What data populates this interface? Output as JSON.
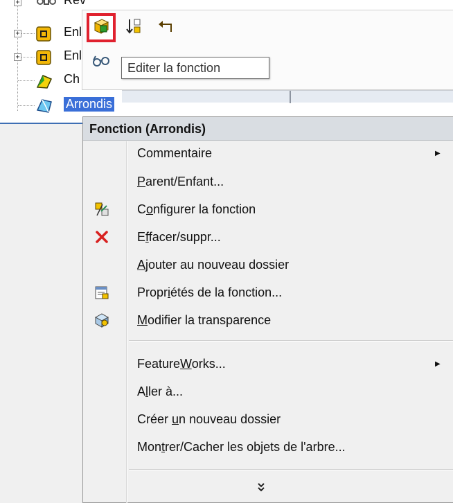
{
  "tree": {
    "items": [
      {
        "label": "Rev",
        "expander": "+",
        "icon": "revolve-feature-icon"
      },
      {
        "label": "Enl",
        "expander": "+",
        "icon": "cut-extrude-feature-icon"
      },
      {
        "label": "Enl",
        "expander": "+",
        "icon": "cut-extrude-feature-icon"
      },
      {
        "label": "Ch",
        "expander": "",
        "icon": "chamfer-feature-icon"
      },
      {
        "label": "Arrondis",
        "expander": "",
        "icon": "fillet-feature-icon",
        "selected": true
      }
    ]
  },
  "toolbar": {
    "buttons": [
      {
        "name": "edit-feature-button",
        "icon": "edit-feature-icon",
        "highlighted": true
      },
      {
        "name": "rollback-button",
        "icon": "rollback-icon"
      },
      {
        "name": "undo-button",
        "icon": "undo-arrow-icon"
      },
      {
        "name": "hide-show-button",
        "icon": "glasses-icon"
      }
    ],
    "tooltip": "Editer la fonction"
  },
  "menu": {
    "header": "Fonction (Arrondis)",
    "items": [
      {
        "pre": "Commentaire",
        "u": "",
        "post": "",
        "submenu": true,
        "icon": ""
      },
      {
        "pre": "",
        "u": "P",
        "post": "arent/Enfant...",
        "submenu": false,
        "icon": ""
      },
      {
        "pre": "C",
        "u": "o",
        "post": "nfigurer la fonction",
        "submenu": false,
        "icon": "configure-feature-icon"
      },
      {
        "pre": "E",
        "u": "f",
        "post": "facer/suppr...",
        "submenu": false,
        "icon": "delete-x-icon"
      },
      {
        "pre": "",
        "u": "A",
        "post": "jouter au nouveau dossier",
        "submenu": false,
        "icon": ""
      },
      {
        "pre": "Propr",
        "u": "i",
        "post": "étés de la fonction...",
        "submenu": false,
        "icon": "feature-properties-icon"
      },
      {
        "pre": "",
        "u": "M",
        "post": "odifier la transparence",
        "submenu": false,
        "icon": "transparency-icon"
      },
      {
        "pre": "Feature",
        "u": "W",
        "post": "orks...",
        "submenu": true,
        "icon": ""
      },
      {
        "pre": "A",
        "u": "l",
        "post": "ler à...",
        "submenu": false,
        "icon": ""
      },
      {
        "pre": "Créer ",
        "u": "u",
        "post": "n nouveau dossier",
        "submenu": false,
        "icon": ""
      },
      {
        "pre": "Mon",
        "u": "t",
        "post": "rer/Cacher les objets de l'arbre...",
        "submenu": false,
        "icon": ""
      }
    ],
    "more_glyph": "¥"
  },
  "colors": {
    "highlight": "#e0212e",
    "selection": "#3a6fd8",
    "menu_bg": "#f0f0f0",
    "delete_red": "#d8201f"
  }
}
